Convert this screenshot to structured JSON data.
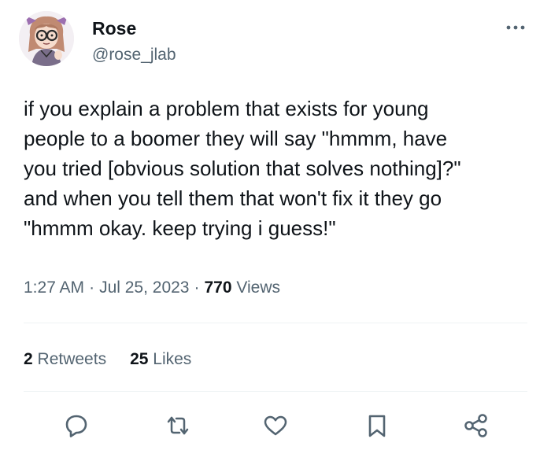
{
  "author": {
    "display_name": "Rose",
    "handle": "@rose_jlab"
  },
  "tweet": {
    "text": "if you explain a problem that exists for young\npeople to a boomer they will say \"hmmm, have\nyou tried [obvious solution that solves nothing]?\"\nand when you tell them that won't fix it they go\n\"hmmm okay. keep trying i guess!\"",
    "time": "1:27 AM",
    "date": "Jul 25, 2023",
    "views_count": "770",
    "views_label": "Views"
  },
  "stats": {
    "retweets_count": "2",
    "retweets_label": "Retweets",
    "likes_count": "25",
    "likes_label": "Likes"
  },
  "icons": {
    "more": "more-horizontal-icon",
    "reply": "reply-bubble-icon",
    "retweet": "retweet-icon",
    "like": "heart-icon",
    "bookmark": "bookmark-icon",
    "share": "share-icon"
  },
  "colors": {
    "text": "#0f1419",
    "secondary": "#536471",
    "divider": "#eff3f4"
  }
}
